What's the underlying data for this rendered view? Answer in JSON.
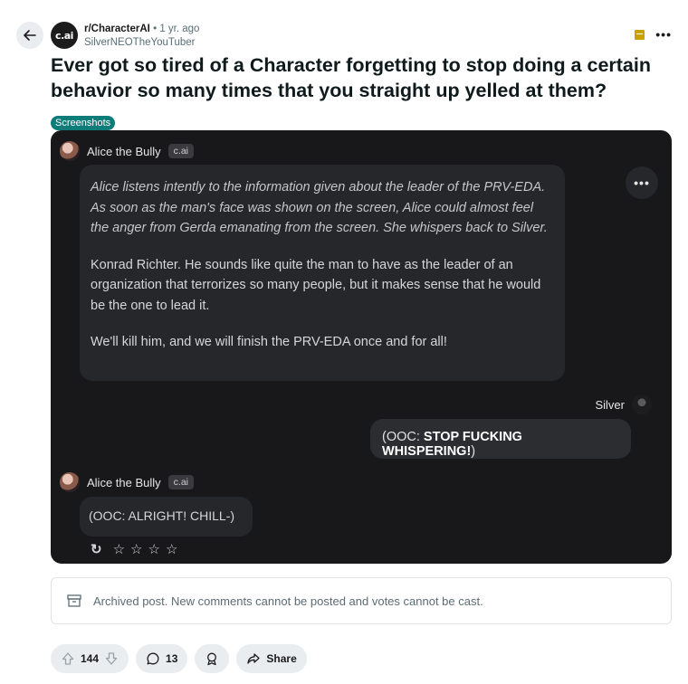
{
  "header": {
    "avatar_text": "c.ai",
    "subreddit": "r/CharacterAI",
    "separator": "•",
    "time": "1 yr. ago",
    "author": "SilverNEOTheYouTuber",
    "more_label": "•••"
  },
  "post": {
    "title": "Ever got so tired of a Character forgetting to stop doing a certain behavior so many times that you straight up yelled at them?",
    "flair": "Screenshots"
  },
  "screenshot": {
    "character_name": "Alice the Bully",
    "tag": "c.ai",
    "message1_action": "Alice listens intently to the information given about the leader of the PRV-EDA. As soon as the man's face was shown on the screen, Alice could almost feel the anger from Gerda emanating from the screen. She whispers back to Silver.",
    "message1_para2": "Konrad Richter. He sounds like quite the man to have as the leader of an organization that terrorizes so many people, but it makes sense that he would be the one to lead it.",
    "message1_para3": "We'll kill him, and we will finish the PRV-EDA once and for all!",
    "more_label": "•••",
    "user_name": "Silver",
    "user_message_prefix": "(OOC: ",
    "user_message_caps": "STOP FUCKING WHISPERING!",
    "user_message_suffix": ")",
    "reply": "(OOC: ALRIGHT! CHILL-)",
    "refresh_icon": "↻",
    "stars": [
      "☆",
      "☆",
      "☆",
      "☆"
    ]
  },
  "archived": {
    "text": "Archived post. New comments cannot be posted and votes cannot be cast."
  },
  "actions": {
    "upvotes": "144",
    "comments": "13",
    "share_label": "Share"
  },
  "colors": {
    "flair_bg": "#0e7c78",
    "screenshot_bg": "#18181b",
    "bubble_bg": "#26272b",
    "pill_bg": "#eaedef",
    "archive_badge": "#c9a100"
  }
}
